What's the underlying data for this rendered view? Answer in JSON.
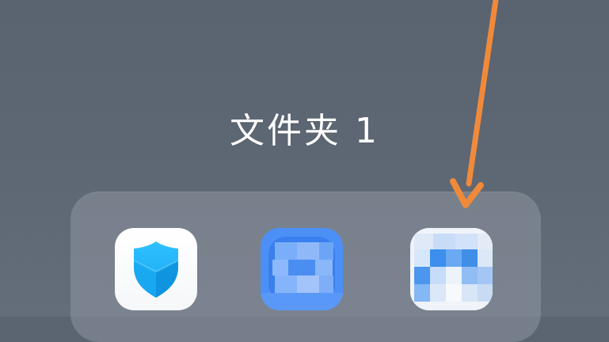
{
  "folder": {
    "title": "文件夹 1"
  },
  "apps": [
    {
      "icon": "security-shield-icon"
    },
    {
      "icon": "blurred-blue-app-icon"
    },
    {
      "icon": "blurred-light-app-icon"
    }
  ],
  "annotation": {
    "type": "arrow",
    "color": "#f08a3a"
  }
}
